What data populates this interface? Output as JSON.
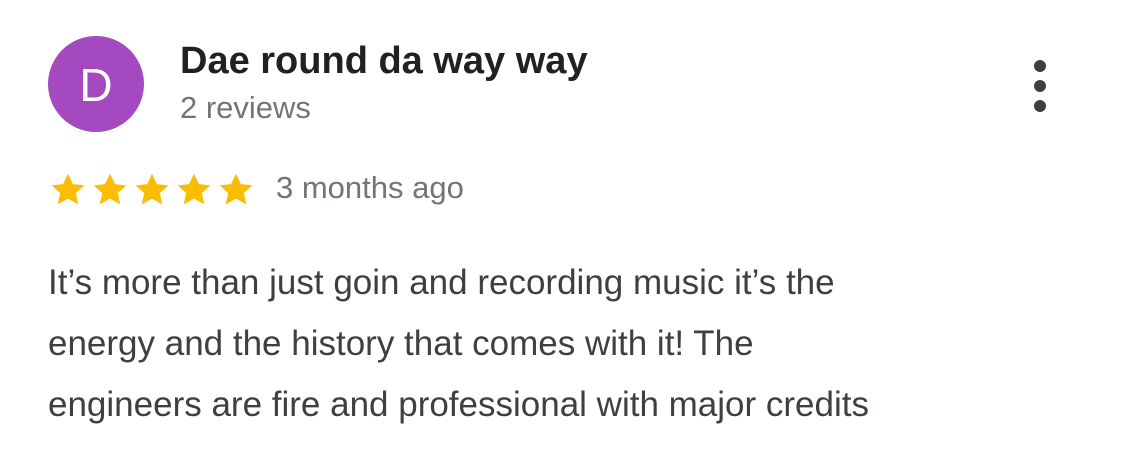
{
  "review": {
    "avatar_letter": "D",
    "avatar_color": "#A549C0",
    "author_name": "Dae round da way way",
    "review_count": "2 reviews",
    "rating": 5,
    "rating_max": 5,
    "star_color": "#FBBC04",
    "date": "3 months ago",
    "text_lines": [
      "It’s more than just goin and recording music it’s the",
      "energy and the history that comes with it! The",
      "engineers are fire and professional with major credits"
    ],
    "more_icon": "more-vert-icon"
  }
}
